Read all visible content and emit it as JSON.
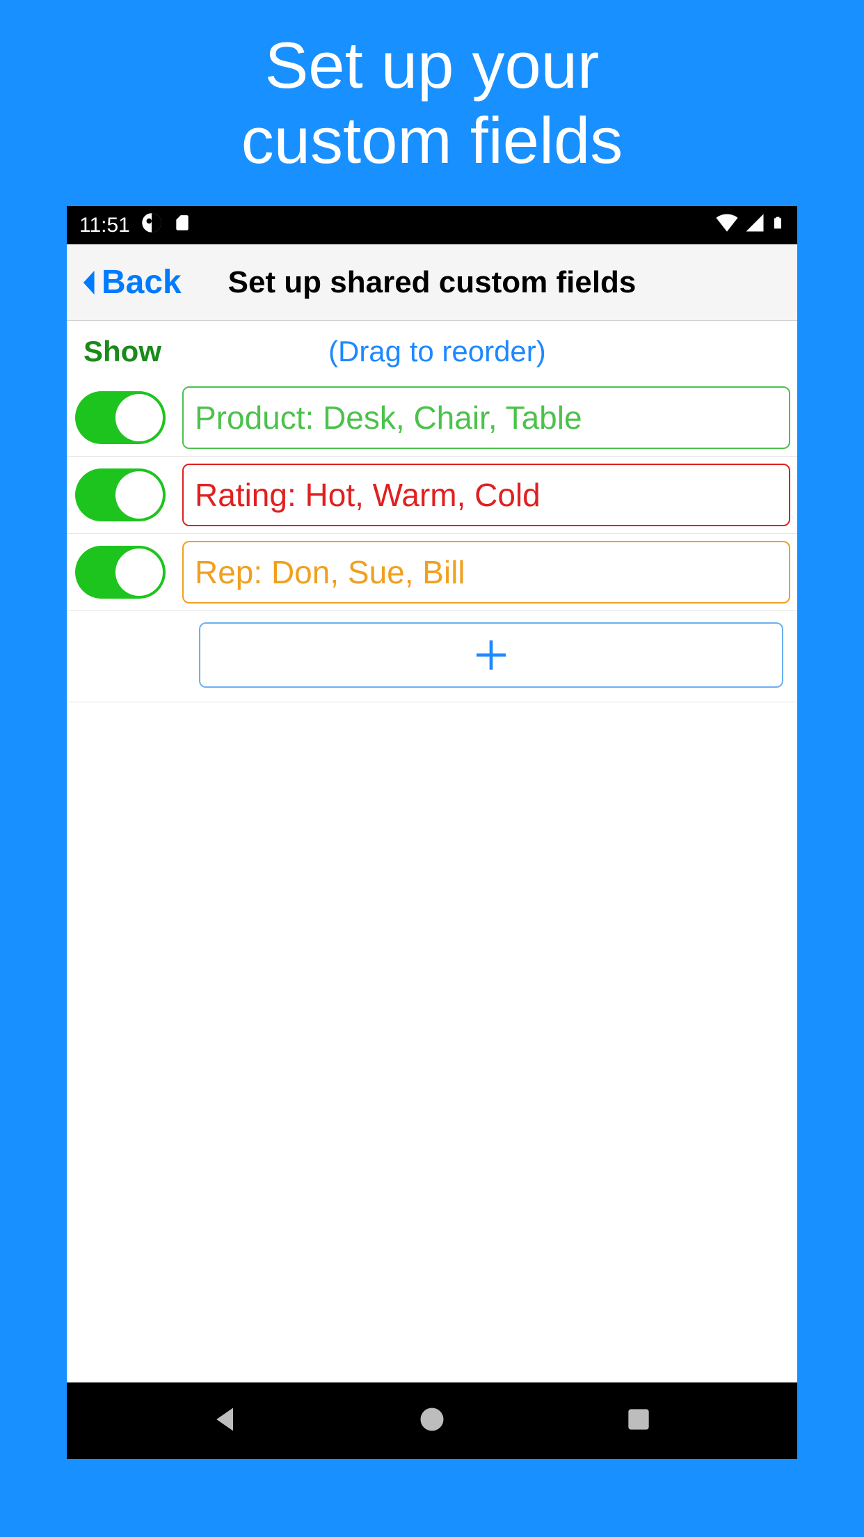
{
  "promo": {
    "line1": "Set up your",
    "line2": "custom fields"
  },
  "status": {
    "time": "11:51"
  },
  "header": {
    "back": "Back",
    "title": "Set up shared custom fields"
  },
  "sub": {
    "show": "Show",
    "hint": "(Drag to reorder)"
  },
  "fields": [
    {
      "enabled": true,
      "text": "Product: Desk, Chair, Table",
      "color": "green"
    },
    {
      "enabled": true,
      "text": "Rating: Hot, Warm, Cold",
      "color": "red"
    },
    {
      "enabled": true,
      "text": "Rep: Don, Sue, Bill",
      "color": "orange"
    }
  ]
}
